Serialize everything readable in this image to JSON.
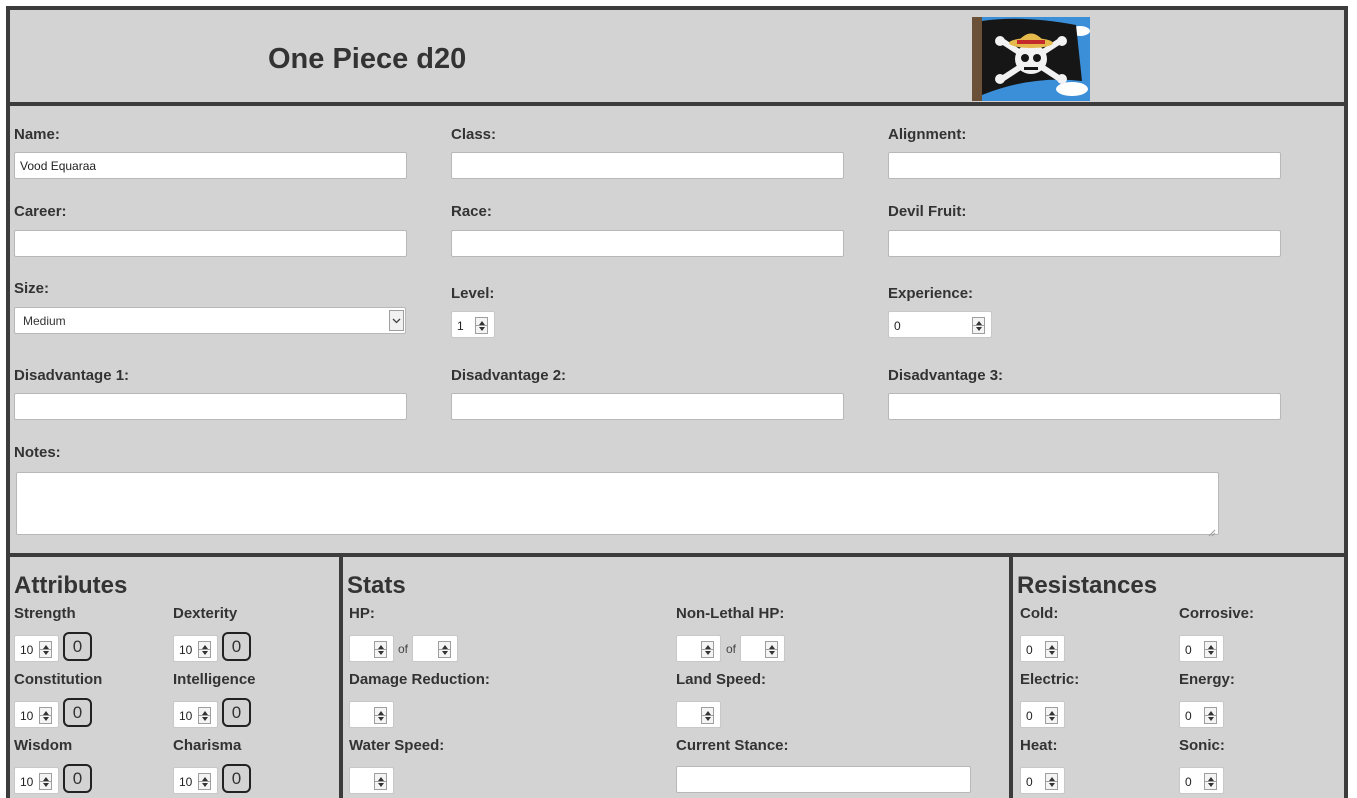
{
  "header": {
    "title": "One Piece d20",
    "logo_icon": "straw-hat-jolly-roger-flag"
  },
  "info": {
    "name_label": "Name:",
    "name_value": "Vood Equaraa",
    "class_label": "Class:",
    "class_value": "",
    "alignment_label": "Alignment:",
    "alignment_value": "",
    "career_label": "Career:",
    "career_value": "",
    "race_label": "Race:",
    "race_value": "",
    "devil_fruit_label": "Devil Fruit:",
    "devil_fruit_value": "",
    "size_label": "Size:",
    "size_value": "Medium",
    "level_label": "Level:",
    "level_value": "1",
    "experience_label": "Experience:",
    "experience_value": "0",
    "disadvantage1_label": "Disadvantage 1:",
    "disadvantage1_value": "",
    "disadvantage2_label": "Disadvantage 2:",
    "disadvantage2_value": "",
    "disadvantage3_label": "Disadvantage 3:",
    "disadvantage3_value": "",
    "notes_label": "Notes:",
    "notes_value": ""
  },
  "attributes": {
    "title": "Attributes",
    "items": [
      {
        "label": "Strength",
        "value": "10",
        "mod": "0"
      },
      {
        "label": "Dexterity",
        "value": "10",
        "mod": "0"
      },
      {
        "label": "Constitution",
        "value": "10",
        "mod": "0"
      },
      {
        "label": "Intelligence",
        "value": "10",
        "mod": "0"
      },
      {
        "label": "Wisdom",
        "value": "10",
        "mod": "0"
      },
      {
        "label": "Charisma",
        "value": "10",
        "mod": "0"
      }
    ]
  },
  "stats": {
    "title": "Stats",
    "hp_label": "HP:",
    "of_text": "of",
    "nonlethal_label": "Non-Lethal HP:",
    "damage_reduction_label": "Damage Reduction:",
    "land_speed_label": "Land Speed:",
    "water_speed_label": "Water Speed:",
    "current_stance_label": "Current Stance:",
    "current_stance_value": ""
  },
  "resistances": {
    "title": "Resistances",
    "items": [
      {
        "label": "Cold:",
        "value": "0"
      },
      {
        "label": "Corrosive:",
        "value": "0"
      },
      {
        "label": "Electric:",
        "value": "0"
      },
      {
        "label": "Energy:",
        "value": "0"
      },
      {
        "label": "Heat:",
        "value": "0"
      },
      {
        "label": "Sonic:",
        "value": "0"
      }
    ]
  }
}
